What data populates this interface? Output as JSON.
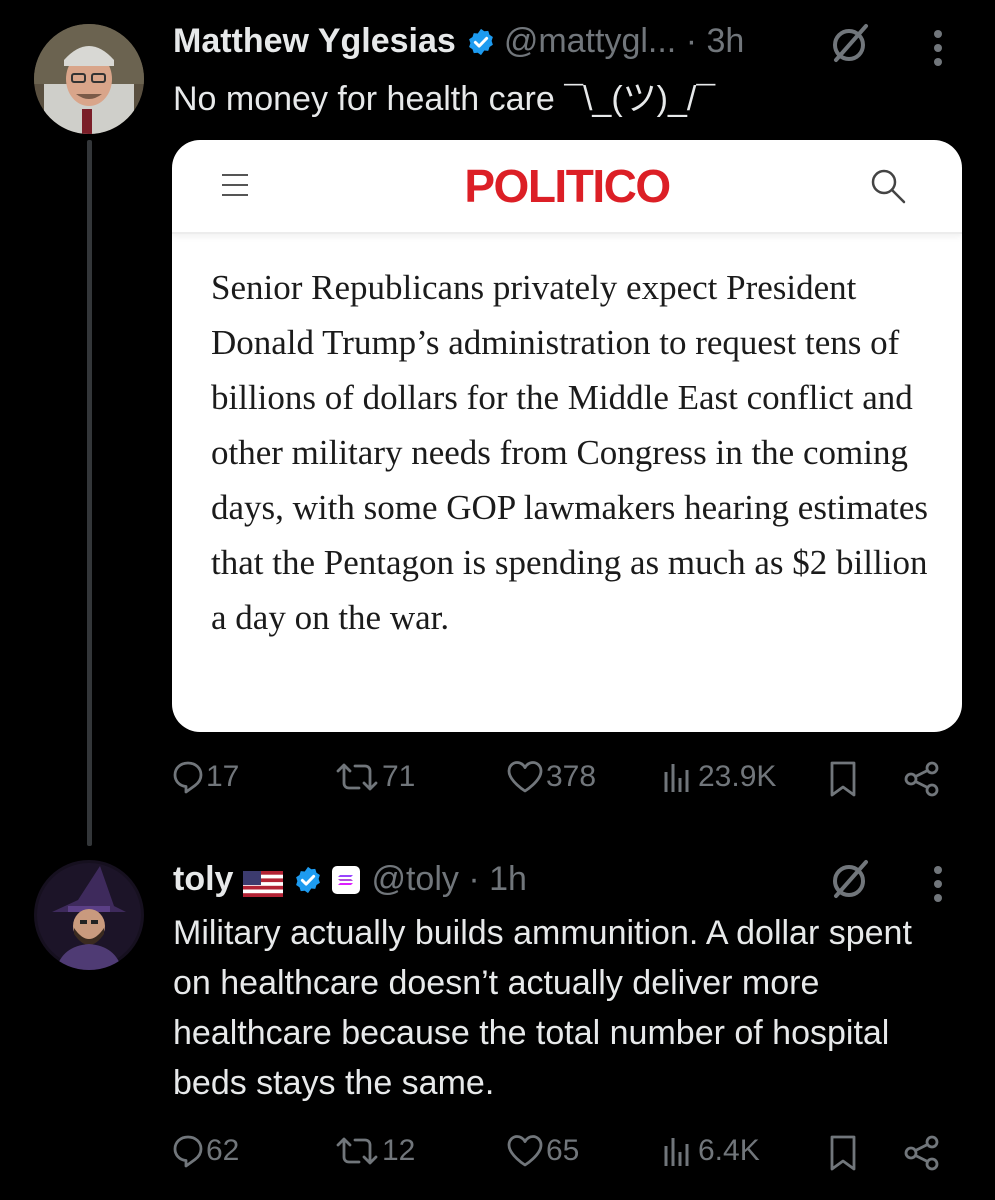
{
  "tweets": [
    {
      "author": {
        "display_name": "Matthew Yglesias",
        "handle": "@mattygl...",
        "time": "3h",
        "verified_color": "#1d9bf0"
      },
      "text": "No money for health care ¯\\_(ツ)_/¯",
      "card": {
        "logo": "POLITICO",
        "logo_color": "#dc1f26",
        "icons": [
          "menu-icon",
          "search-icon"
        ],
        "body": "Senior Republicans privately expect President Donald Trump’s administration to request tens of billions of dollars for the Middle East conflict and other military needs from Congress in the coming days, with some GOP lawmakers hearing estimates that the Pentagon is spending as much as $2 billion a day on the war."
      },
      "stats": {
        "replies": "17",
        "reposts": "71",
        "likes": "378",
        "views": "23.9K"
      }
    },
    {
      "author": {
        "display_name": "toly",
        "badges": [
          "us-flag-icon",
          "verified-icon",
          "solana-affiliate-icon"
        ],
        "handle": "@toly",
        "time": "1h",
        "verified_color": "#1d9bf0"
      },
      "text": "Military actually builds ammunition.  A dollar spent on healthcare doesn’t actually deliver more healthcare because the total number of hospital beds stays the same.",
      "stats": {
        "replies": "62",
        "reposts": "12",
        "likes": "65",
        "views": "6.4K"
      }
    }
  ],
  "colors": {
    "background": "#000000",
    "text": "#e7e9ea",
    "muted": "#71767b",
    "thread_line": "#333639"
  }
}
